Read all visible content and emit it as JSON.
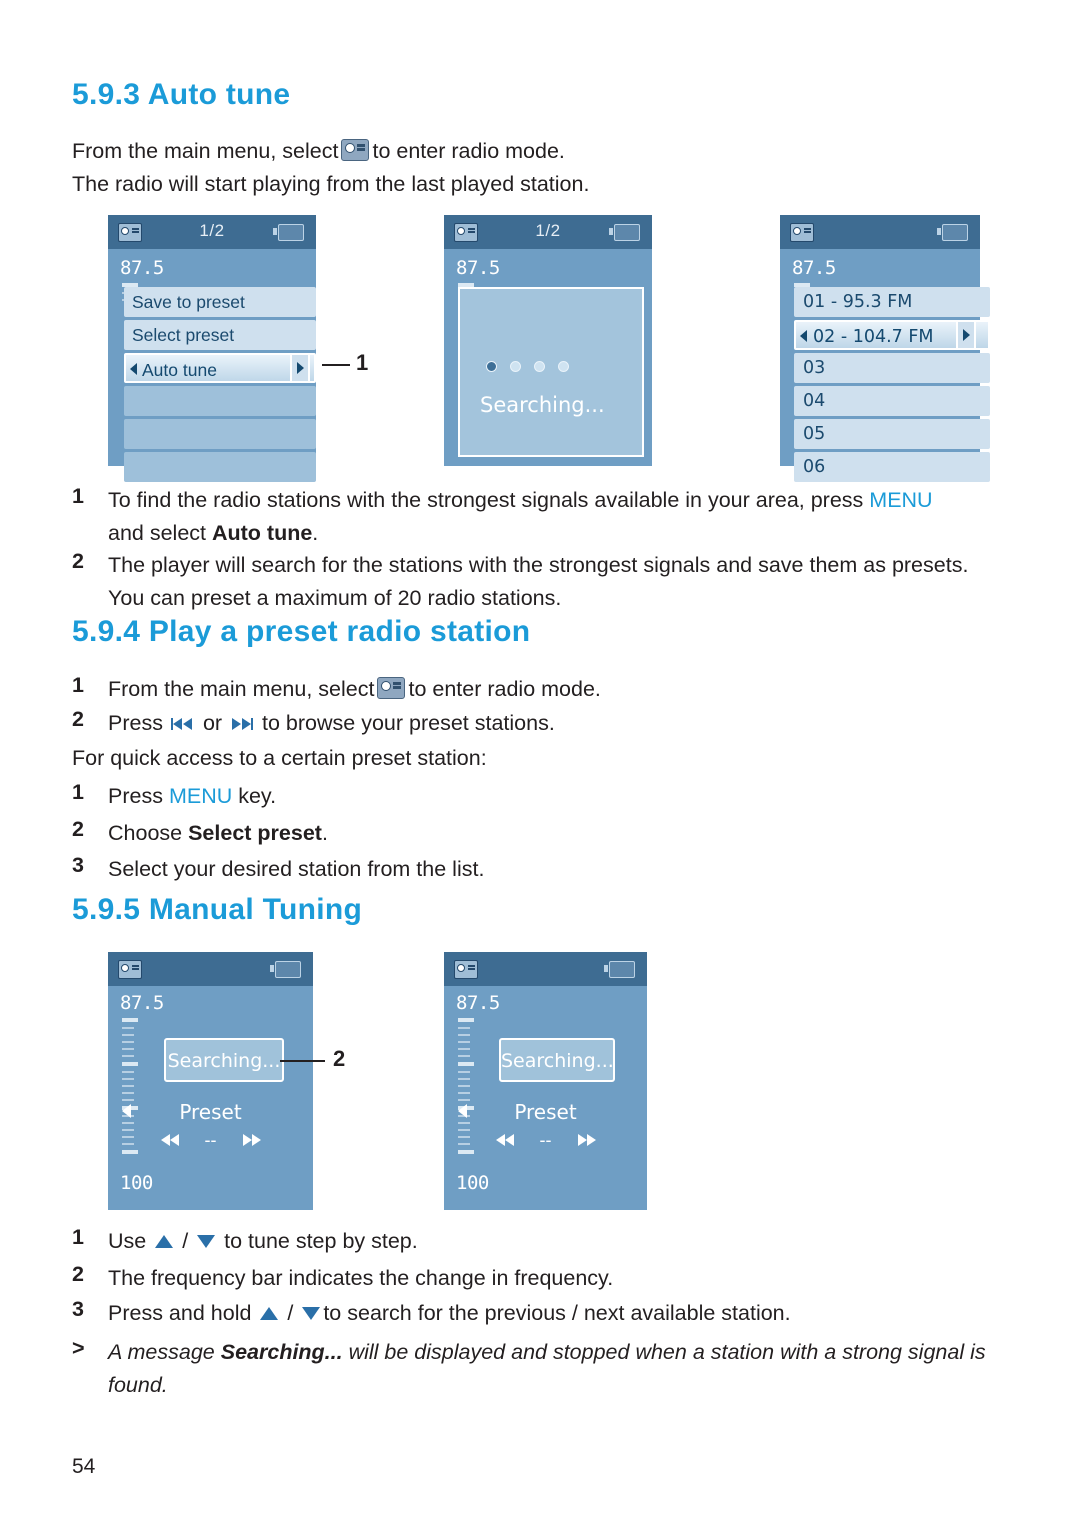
{
  "page": {
    "number": "54"
  },
  "sections": {
    "auto_tune": {
      "heading": "5.9.3 Auto tune",
      "intro_line1_a": "From the main menu, select",
      "intro_line1_b": "to enter radio mode.",
      "intro_line2": "The radio will start playing from the last played station.",
      "steps": [
        {
          "num": "1",
          "text_a": "To find the radio stations with the strongest signals available in your area, press ",
          "menu": "MENU",
          "text_b": "and select ",
          "bold": "Auto tune",
          "text_c": "."
        },
        {
          "num": "2",
          "text_a": "The player will search for the stations with the strongest signals and save them as presets.",
          "text_b": "You can preset a maximum of 20 radio stations."
        }
      ],
      "callout_1": "1"
    },
    "play_preset": {
      "heading": "5.9.4 Play a preset radio station",
      "steps": [
        {
          "num": "1",
          "text_a": "From the main menu, select",
          "text_b": "to enter radio mode."
        },
        {
          "num": "2",
          "text_a": "Press",
          "text_b": "or",
          "text_c": "to browse your preset stations."
        }
      ],
      "quick_access": "For quick access to a certain preset station:",
      "substeps": [
        {
          "num": "1",
          "text_a": "Press ",
          "menu": "MENU",
          "text_b": " key."
        },
        {
          "num": "2",
          "text_a": "Choose ",
          "bold": "Select preset",
          "text_b": "."
        },
        {
          "num": "3",
          "text_a": "Select your desired station from the list."
        }
      ]
    },
    "manual_tuning": {
      "heading": "5.9.5 Manual Tuning",
      "callout_2": "2",
      "steps": [
        {
          "num": "1",
          "text_a": "Use ",
          "text_b": " / ",
          "text_c": " to tune step by step."
        },
        {
          "num": "2",
          "text_a": "The frequency bar indicates the change in frequency."
        },
        {
          "num": "3",
          "text_a": "Press and hold ",
          "text_b": " / ",
          "text_c": "to search for the previous / next available station."
        }
      ],
      "note": {
        "marker": ">",
        "text_a": "A message ",
        "bold": "Searching...",
        "text_b": " will be displayed and stopped when a station with a strong signal is found."
      }
    }
  },
  "screens": {
    "menu_screen": {
      "page_indicator": "1/2",
      "frequency": "87.5",
      "items": [
        "Save to preset",
        "Select preset",
        "Auto tune",
        "",
        "",
        ""
      ],
      "selected_index": 2
    },
    "searching_screen": {
      "page_indicator": "1/2",
      "frequency": "87.5",
      "searching_label": "Searching..."
    },
    "preset_screen": {
      "frequency": "87.5",
      "items": [
        "01 - 95.3 FM",
        "02 - 104.7 FM",
        "03",
        "04",
        "05",
        "06"
      ],
      "selected_index": 1
    },
    "manual_screen_left": {
      "frequency_top": "87.5",
      "frequency_bottom": "100",
      "searching_label": "Searching...",
      "preset_label": "Preset",
      "dash": "--"
    },
    "manual_screen_right": {
      "frequency_top": "87.5",
      "frequency_bottom": "100",
      "searching_label": "Searching...",
      "preset_label": "Preset",
      "dash": "--"
    }
  },
  "colors": {
    "accent": "#1b9bd8",
    "text": "#231f20",
    "screen_bg": "#6f9ec4",
    "screen_topbar": "#3e6c92"
  }
}
